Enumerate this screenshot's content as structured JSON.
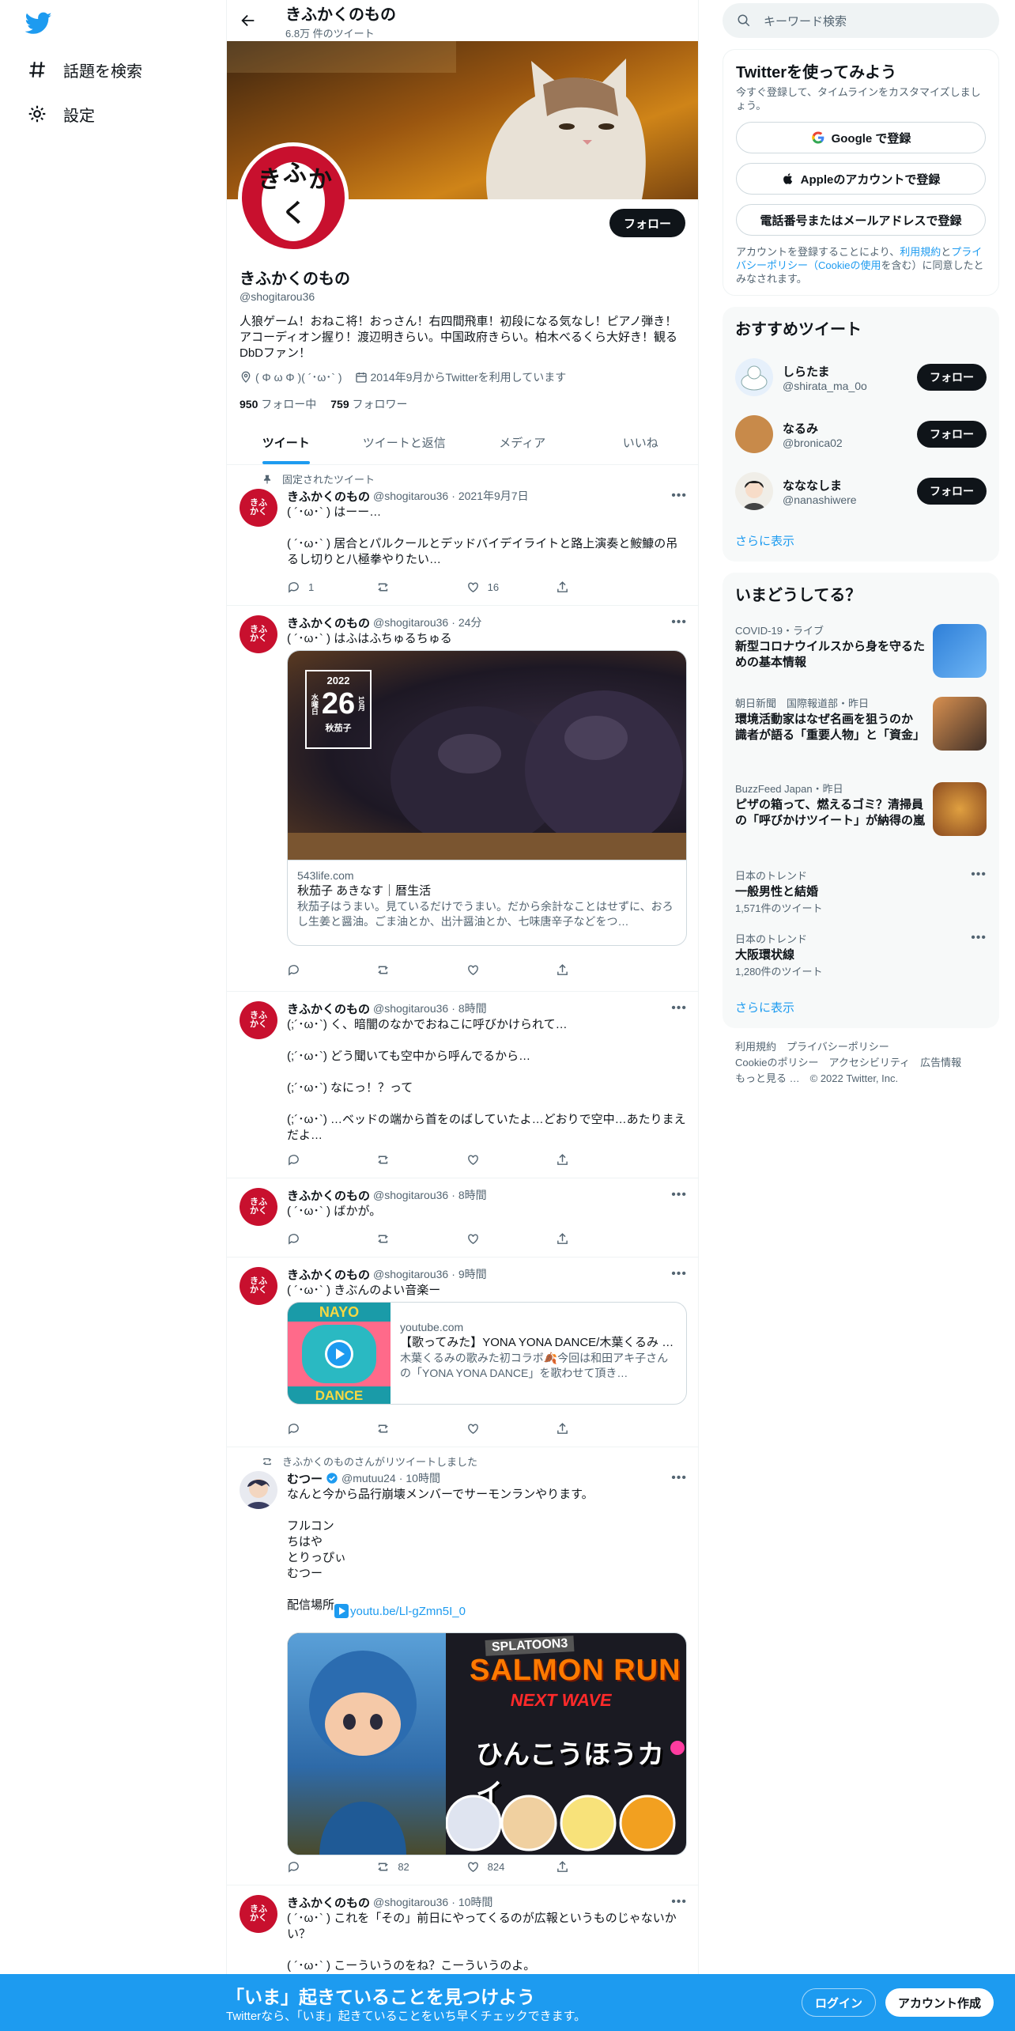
{
  "nav": {
    "explore_label": "話題を検索",
    "settings_label": "設定"
  },
  "profile": {
    "name": "きふかくのもの",
    "tweet_count": "6.8万 件のツイート",
    "handle": "@shogitarou36",
    "bio": "人狼ゲーム！おねこ将！おっさん！右四間飛車！初段になる気なし！ピアノ弾き！アコーディオン握り！渡辺明きらい。中国政府きらい。柏木べるくら大好き！観るDbDファン！",
    "location": "( Φ ω Φ )( ´･ω･` )",
    "joined": "2014年9月からTwitterを利用しています",
    "following_count": "950",
    "following_label": "フォロー中",
    "followers_count": "759",
    "followers_label": "フォロワー",
    "follow_label": "フォロー",
    "avatar_text": "きふかく"
  },
  "tabs": [
    "ツイート",
    "ツイートと返信",
    "メディア",
    "いいね"
  ],
  "tweets": [
    {
      "context": "固定されたツイート",
      "name": "きふかくのもの",
      "handle": "@shogitarou36",
      "time": "2021年9月7日",
      "text": "( ´･ω･` ) はーー…\n\n( ´･ω･` ) 居合とパルクールとデッドバイデイライトと路上演奏と鮟鱇の吊るし切りと八極拳やりたい…",
      "replies": "1",
      "retweets": "",
      "likes": "16"
    },
    {
      "name": "きふかくのもの",
      "handle": "@shogitarou36",
      "time": "24分",
      "text": "( ´･ω･` ) はふはふちゅるちゅる",
      "card": {
        "domain": "543life.com",
        "title": "秋茄子 あきなす｜暦生活",
        "desc": "秋茄子はうまい。見ているだけでうまい。だから余計なことはせずに、おろし生姜と醤油。ごま油とか、出汁醤油とか、七味唐辛子などをつ…",
        "badge_year": "2022",
        "badge_date": "26",
        "badge_month": "10月",
        "badge_weekday": "水曜日",
        "badge_label": "秋茄子"
      },
      "replies": "",
      "retweets": "",
      "likes": ""
    },
    {
      "name": "きふかくのもの",
      "handle": "@shogitarou36",
      "time": "8時間",
      "text": "(;´･ω･`) く、暗闇のなかでおねこに呼びかけられて…\n\n(;´･ω･`) どう聞いても空中から呼んでるから…\n\n(;´･ω･`) なにっ！？って\n\n(;´･ω･`) …ベッドの端から首をのばしていたよ…どおりで空中…あたりまえだよ…"
    },
    {
      "name": "きふかくのもの",
      "handle": "@shogitarou36",
      "time": "8時間",
      "text": "( ´･ω･` ) ばかが。"
    },
    {
      "name": "きふかくのもの",
      "handle": "@shogitarou36",
      "time": "9時間",
      "text": "( ´･ω･` ) きぶんのよい音楽ー",
      "card": {
        "domain": "youtube.com",
        "title": "【歌ってみた】YONA YONA DANCE/木葉くるみ …",
        "desc": "木葉くるみの歌みた初コラボ🍂今回は和田アキ子さんの「YONA YONA DANCE」を歌わせて頂き…",
        "thumb_top": "NAYO",
        "thumb_bottom": "DANCE"
      }
    },
    {
      "context": "きふかくのものさんがリツイートしました",
      "name": "むつー",
      "handle": "@mutuu24",
      "time": "10時間",
      "text": "なんと今から品行崩壊メンバーでサーモンランやります。\n\nフルコン\nちはや\nとりっぴぃ\nむつー\n\n配信場所",
      "link": "youtu.be/Ll-gZmn5I_0",
      "replies": "",
      "retweets": "82",
      "likes": "824",
      "image": {
        "logo_top": "SPLATOON3",
        "logo_main": "SALMON RUN",
        "logo_sub": "NEXT WAVE",
        "jp_title": "ひんこうほうカイ"
      }
    },
    {
      "name": "きふかくのもの",
      "handle": "@shogitarou36",
      "time": "10時間",
      "text": "( ´･ω･` ) これを「その」前日にやってくるのが広報というものじゃないかい？\n\n( ´･ω･` ) こーういうのをね？こーういうのよ。"
    }
  ],
  "sidebar": {
    "search_placeholder": "キーワード検索",
    "signup_title": "Twitterを使ってみよう",
    "signup_sub": "今すぐ登録して、タイムラインをカスタマイズしましょう。",
    "google_label": "Google で登録",
    "apple_label": "Appleのアカウントで登録",
    "phone_label": "電話番号またはメールアドレスで登録",
    "legal_pre": "アカウントを登録することにより、",
    "legal_terms": "利用規約",
    "legal_and": "と",
    "legal_privacy": "プライバシーポリシー（Cookieの使用",
    "legal_post": "を含む）に同意したとみなされます。",
    "rec_title": "おすすめツイート",
    "recs": [
      {
        "name": "しらたま",
        "handle": "@shirata_ma_0o"
      },
      {
        "name": "なるみ",
        "handle": "@bronica02"
      },
      {
        "name": "なななしま",
        "handle": "@nanashiwere"
      }
    ],
    "show_more": "さらに表示",
    "trend_title": "いまどうしてる？",
    "trends": [
      {
        "meta": "COVID-19・ライブ",
        "title": "新型コロナウイルスから身を守るための基本情報"
      },
      {
        "meta": "朝日新聞　国際報道部・昨日",
        "title": "環境活動家はなぜ名画を狙うのか 識者が語る「重要人物」と「資金」"
      },
      {
        "meta": "BuzzFeed Japan・昨日",
        "title": "ピザの箱って、燃えるゴミ？清掃員の「呼びかけツイート」が納得の嵐"
      },
      {
        "meta": "日本のトレンド",
        "title": "一般男性と結婚",
        "count": "1,571件のツイート"
      },
      {
        "meta": "日本のトレンド",
        "title": "大阪環状線",
        "count": "1,280件のツイート"
      }
    ],
    "footer": [
      "利用規約",
      "プライバシーポリシー",
      "Cookieのポリシー",
      "アクセシビリティ",
      "広告情報",
      "もっと見る …",
      "© 2022 Twitter, Inc."
    ]
  },
  "bottom": {
    "headline": "「いま」起きていることを見つけよう",
    "sub": "Twitterなら、「いま」起きていることをいち早くチェックできます。",
    "login": "ログイン",
    "signup": "アカウント作成"
  }
}
